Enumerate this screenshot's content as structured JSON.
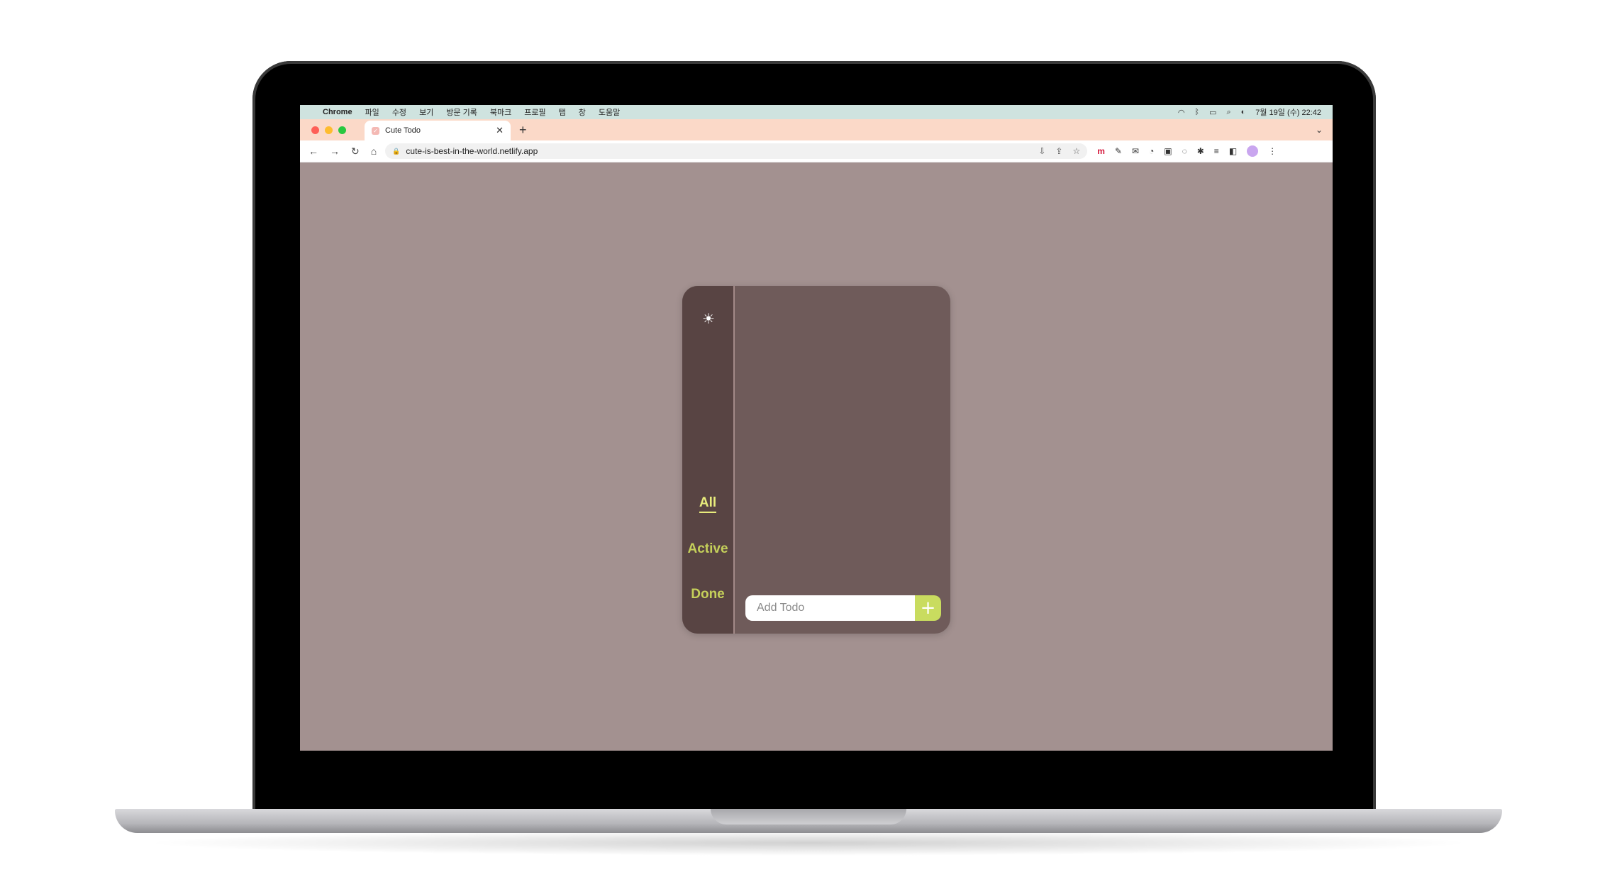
{
  "menubar": {
    "apple": "",
    "app": "Chrome",
    "items": [
      "파일",
      "수정",
      "보기",
      "방문 기록",
      "북마크",
      "프로필",
      "탭",
      "창",
      "도움말"
    ],
    "datetime": "7월 19일 (수) 22:42",
    "status_icons": [
      "wifi-icon",
      "bluetooth-icon",
      "battery-icon",
      "search-icon",
      "control-center-icon"
    ]
  },
  "browser": {
    "tab": {
      "title": "Cute Todo",
      "close": "✕"
    },
    "new_tab": "+",
    "tab_menu": "⌄",
    "nav": {
      "back": "←",
      "forward": "→",
      "reload": "↻",
      "home": "⌂"
    },
    "url": "cute-is-best-in-the-world.netlify.app",
    "url_lock": "🔒",
    "omnibox_actions": [
      "⇩",
      "⇪",
      "☆"
    ],
    "extensions": [
      "m",
      "✎",
      "✉",
      "◔",
      "▣",
      "◌",
      "✱",
      "≡",
      "◧",
      "⋮"
    ]
  },
  "todo": {
    "theme_toggle": "☀",
    "filters": {
      "all": "All",
      "active": "Active",
      "done": "Done"
    },
    "selected_filter": "All",
    "input_placeholder": "Add Todo",
    "input_value": "",
    "add_button": "+"
  },
  "colors": {
    "page_bg": "#a39190",
    "card_bg": "#6f5b5a",
    "sidebar_bg": "#584443",
    "accent": "#c9dc5f",
    "filter_text": "#c5d05a"
  }
}
